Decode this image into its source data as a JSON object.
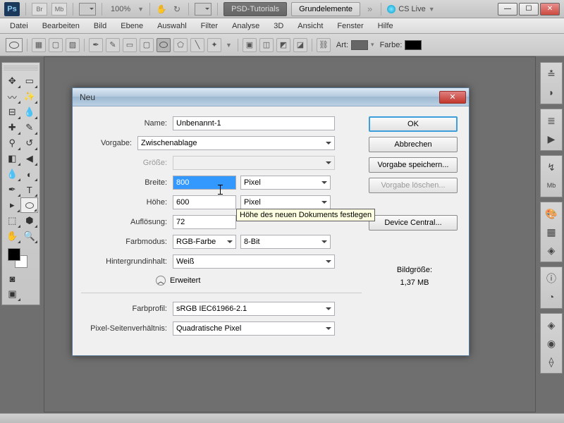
{
  "titlebar": {
    "ps": "Ps",
    "br": "Br",
    "mb": "Mb",
    "zoom": "100%",
    "tab1": "PSD-Tutorials",
    "tab2": "Grundelemente",
    "cslive": "CS Live"
  },
  "menu": [
    "Datei",
    "Bearbeiten",
    "Bild",
    "Ebene",
    "Auswahl",
    "Filter",
    "Analyse",
    "3D",
    "Ansicht",
    "Fenster",
    "Hilfe"
  ],
  "optbar": {
    "art": "Art:",
    "farbe": "Farbe:"
  },
  "dialog": {
    "title": "Neu",
    "name_lbl": "Name:",
    "name_val": "Unbenannt-1",
    "vorgabe_lbl": "Vorgabe:",
    "vorgabe_val": "Zwischenablage",
    "groesse_lbl": "Größe:",
    "breite_lbl": "Breite:",
    "breite_val": "800",
    "breite_unit": "Pixel",
    "hoehe_lbl": "Höhe:",
    "hoehe_val": "600",
    "hoehe_unit": "Pixel",
    "aufl_lbl": "Auflösung:",
    "aufl_val": "72",
    "farbmod_lbl": "Farbmodus:",
    "farbmod_val": "RGB-Farbe",
    "farbmod_bit": "8-Bit",
    "bg_lbl": "Hintergrundinhalt:",
    "bg_val": "Weiß",
    "erweitert": "Erweitert",
    "profil_lbl": "Farbprofil:",
    "profil_val": "sRGB IEC61966-2.1",
    "pixel_lbl": "Pixel-Seitenverhältnis:",
    "pixel_val": "Quadratische Pixel",
    "ok": "OK",
    "abbrechen": "Abbrechen",
    "speichern": "Vorgabe speichern...",
    "loeschen": "Vorgabe löschen...",
    "device": "Device Central...",
    "bildgroesse_lbl": "Bildgröße:",
    "bildgroesse_val": "1,37 MB",
    "tooltip": "Höhe des neuen Dokuments festlegen"
  }
}
